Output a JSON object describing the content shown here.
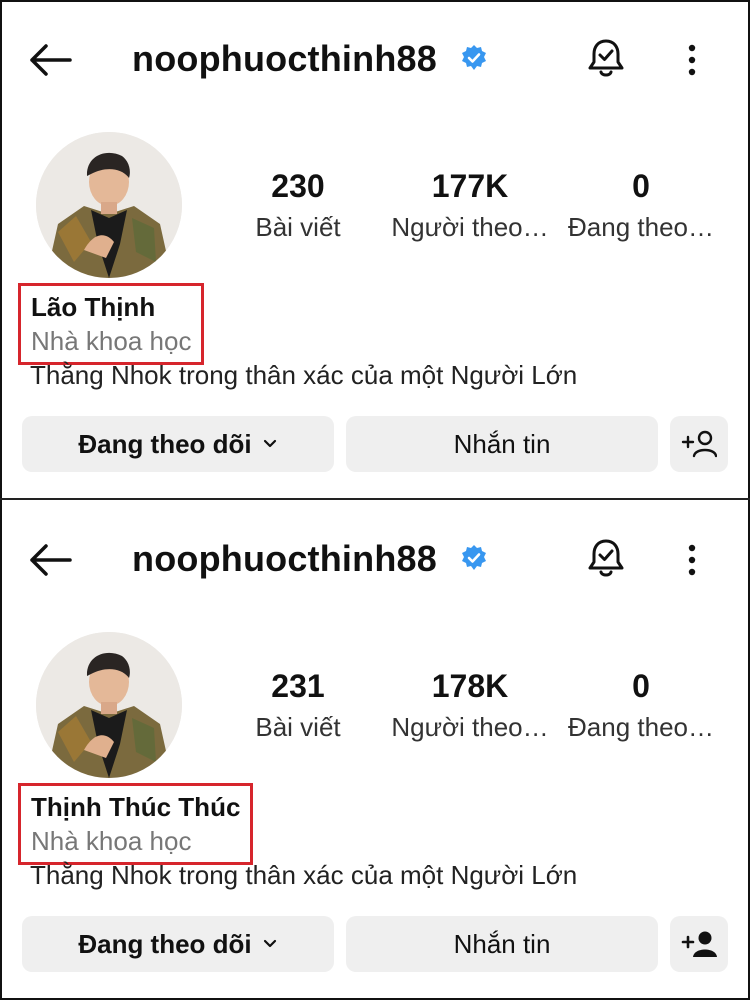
{
  "panels": [
    {
      "username": "noophuocthinh88",
      "stats": [
        {
          "value": "230",
          "label": "Bài viết"
        },
        {
          "value": "177K",
          "label": "Người theo…"
        },
        {
          "value": "0",
          "label": "Đang theo…"
        }
      ],
      "full_name": "Lão Thịnh",
      "category": "Nhà khoa học",
      "bio": "Thằng Nhok trong thân xác của một Người Lớn",
      "follow_button": "Đang theo dõi",
      "message_button": "Nhắn tin",
      "add_user_icon": "add-user-outline-icon"
    },
    {
      "username": "noophuocthinh88",
      "stats": [
        {
          "value": "231",
          "label": "Bài viết"
        },
        {
          "value": "178K",
          "label": "Người theo…"
        },
        {
          "value": "0",
          "label": "Đang theo…"
        }
      ],
      "full_name": "Thịnh Thúc Thúc",
      "category": "Nhà khoa học",
      "bio": "Thằng Nhok trong thân xác của một Người Lớn",
      "follow_button": "Đang theo dõi",
      "message_button": "Nhắn tin",
      "add_user_icon": "add-user-filled-icon"
    }
  ],
  "colors": {
    "highlight_border": "#d6252c",
    "verified_blue": "#3897f0",
    "button_bg": "#efefef"
  }
}
